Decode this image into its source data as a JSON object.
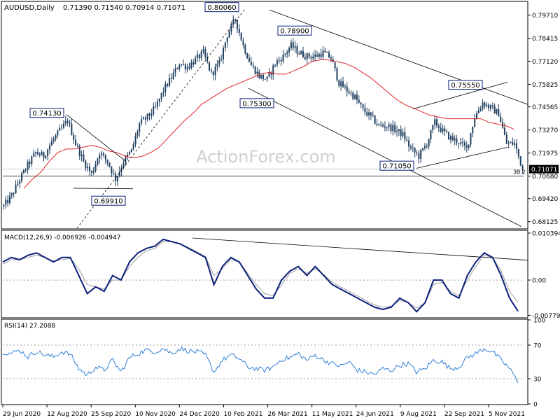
{
  "header": {
    "symbol": "AUDUSD,Daily",
    "ohlc": "0.71390 0.71540 0.70914 0.71071"
  },
  "watermark": "ActionForex.com",
  "colors": {
    "background": "#ffffff",
    "candle": "#1f3f5f",
    "ma": "#e0262b",
    "macd": "#0a1f7a",
    "signal": "#a0a0a0",
    "rsi": "#2f7fd6",
    "trendline": "#000000",
    "label_border": "#0a1f7a",
    "current_price_bg": "#000000"
  },
  "chart_data": [
    {
      "type": "candlestick",
      "name": "AUDUSD Daily price",
      "symbol": "AUDUSD",
      "timeframe": "Daily",
      "ylim": [
        0.6776,
        0.804
      ],
      "y_ticks": [
        "0.79710",
        "0.78415",
        "0.77120",
        "0.75825",
        "0.74565",
        "0.73270",
        "0.71975",
        "0.70680",
        "0.69420",
        "0.68125"
      ],
      "current_price": "0.71071",
      "fib_label": "38.2",
      "fib_level": 0.7068,
      "x_ticks": [
        "29 Jun 2020",
        "12 Aug 2020",
        "25 Sep 2020",
        "10 Nov 2020",
        "24 Dec 2020",
        "10 Feb 2021",
        "26 Mar 2021",
        "11 May 2021",
        "24 Jun 2021",
        "9 Aug 2021",
        "22 Sep 2021",
        "5 Nov 2021"
      ],
      "annotations": [
        {
          "label": "0.80060",
          "value": 0.8006
        },
        {
          "label": "0.78900",
          "value": 0.789
        },
        {
          "label": "0.75300",
          "value": 0.753
        },
        {
          "label": "0.74130",
          "value": 0.7413
        },
        {
          "label": "0.69910",
          "value": 0.6991
        },
        {
          "label": "0.71050",
          "value": 0.7105
        },
        {
          "label": "0.75550",
          "value": 0.7555
        }
      ],
      "closes_weekly": [
        0.69,
        0.696,
        0.705,
        0.713,
        0.72,
        0.718,
        0.726,
        0.732,
        0.738,
        0.725,
        0.715,
        0.708,
        0.72,
        0.715,
        0.705,
        0.715,
        0.721,
        0.736,
        0.74,
        0.745,
        0.755,
        0.762,
        0.77,
        0.768,
        0.772,
        0.776,
        0.764,
        0.77,
        0.786,
        0.795,
        0.78,
        0.769,
        0.763,
        0.761,
        0.77,
        0.774,
        0.78,
        0.776,
        0.774,
        0.774,
        0.776,
        0.773,
        0.759,
        0.755,
        0.751,
        0.744,
        0.74,
        0.735,
        0.735,
        0.733,
        0.73,
        0.722,
        0.718,
        0.725,
        0.737,
        0.732,
        0.728,
        0.726,
        0.722,
        0.74,
        0.748,
        0.745,
        0.742,
        0.725,
        0.725,
        0.7107
      ],
      "ma_weekly": [
        0.7,
        0.705,
        0.709,
        0.715,
        0.72,
        0.722,
        0.722,
        0.723,
        0.724,
        0.723,
        0.721,
        0.72,
        0.718,
        0.717,
        0.718,
        0.72,
        0.723,
        0.728,
        0.733,
        0.738,
        0.742,
        0.747,
        0.75,
        0.753,
        0.756,
        0.758,
        0.76,
        0.762,
        0.764,
        0.765,
        0.764,
        0.764,
        0.766,
        0.768,
        0.771,
        0.772,
        0.772,
        0.771,
        0.77,
        0.768,
        0.765,
        0.762,
        0.758,
        0.754,
        0.75,
        0.747,
        0.745,
        0.743,
        0.741,
        0.74,
        0.739,
        0.739,
        0.739,
        0.739,
        0.739,
        0.737,
        0.736,
        0.735,
        0.733
      ]
    },
    {
      "type": "line",
      "name": "MACD(12,26,9) -0.006926 -0.004947",
      "ylim": [
        -0.0082,
        0.0107
      ],
      "y_ticks": [
        "0.010394",
        "0.00",
        "-0.007797"
      ],
      "macd_weekly": [
        0.004,
        0.005,
        0.0045,
        0.0055,
        0.006,
        0.005,
        0.004,
        0.005,
        0.005,
        0.001,
        -0.003,
        -0.0015,
        -0.0025,
        0.001,
        0.0,
        0.004,
        0.006,
        0.007,
        0.0075,
        0.009,
        0.0085,
        0.008,
        0.007,
        0.006,
        0.005,
        -0.001,
        0.003,
        0.005,
        0.004,
        0.001,
        -0.002,
        -0.004,
        -0.004,
        0.0,
        0.002,
        0.003,
        0.001,
        0.003,
        0.001,
        -0.001,
        -0.002,
        -0.003,
        -0.004,
        -0.005,
        -0.006,
        -0.0065,
        -0.006,
        -0.004,
        -0.005,
        -0.007,
        -0.005,
        0.0,
        0.0,
        -0.003,
        -0.004,
        0.001,
        0.004,
        0.006,
        0.005,
        0.001,
        -0.004,
        -0.0069
      ],
      "signal_weekly": [
        0.0035,
        0.0045,
        0.0045,
        0.005,
        0.0055,
        0.005,
        0.0042,
        0.0045,
        0.0048,
        0.0025,
        -0.001,
        -0.0015,
        -0.002,
        0.0,
        0.0,
        0.003,
        0.005,
        0.0065,
        0.007,
        0.0085,
        0.0085,
        0.008,
        0.0072,
        0.0062,
        0.0052,
        0.001,
        0.0025,
        0.0045,
        0.004,
        0.0015,
        -0.001,
        -0.003,
        -0.0035,
        -0.001,
        0.0015,
        0.0025,
        0.0015,
        0.0025,
        0.0012,
        -0.0005,
        -0.0015,
        -0.0025,
        -0.0035,
        -0.0045,
        -0.0055,
        -0.006,
        -0.0058,
        -0.0045,
        -0.005,
        -0.0062,
        -0.005,
        -0.001,
        -0.0005,
        -0.0025,
        -0.0035,
        0.0,
        0.003,
        0.0055,
        0.005,
        0.002,
        -0.0025,
        -0.0049
      ]
    },
    {
      "type": "line",
      "name": "RSI(14) 27.2088",
      "ylim": [
        0,
        100
      ],
      "y_ticks": [
        "100",
        "70",
        "30",
        "0"
      ],
      "rsi_weekly": [
        62,
        60,
        64,
        56,
        63,
        58,
        56,
        62,
        59,
        42,
        34,
        44,
        40,
        52,
        38,
        55,
        60,
        64,
        62,
        66,
        60,
        66,
        63,
        62,
        58,
        38,
        52,
        58,
        54,
        44,
        42,
        40,
        44,
        53,
        55,
        60,
        52,
        58,
        52,
        48,
        45,
        50,
        40,
        38,
        35,
        42,
        40,
        46,
        48,
        38,
        42,
        52,
        50,
        42,
        44,
        55,
        60,
        66,
        62,
        52,
        42,
        27
      ]
    }
  ]
}
